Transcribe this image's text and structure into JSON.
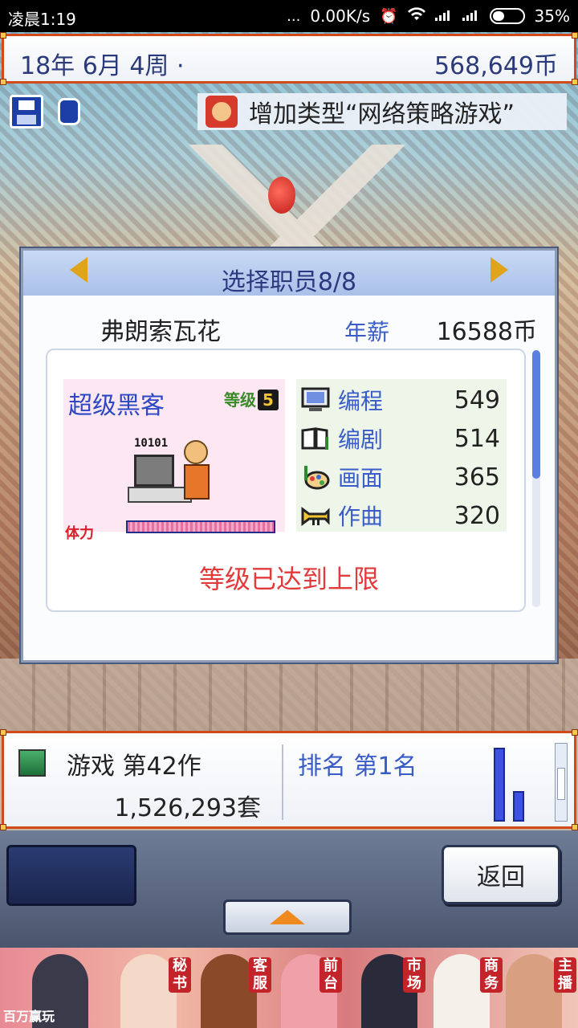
{
  "status_bar": {
    "time": "凌晨1:19",
    "dots": "...",
    "network_speed": "0.00K/s",
    "battery": "35%"
  },
  "top_bar": {
    "date": "18年 6月 4周 ·",
    "money": "568,649币"
  },
  "notice": {
    "text": "增加类型“网络策略游戏”"
  },
  "dialog": {
    "title": "选择职员8/8",
    "employee_name": "弗朗索瓦花",
    "salary_label": "年薪",
    "salary_value": "16588币",
    "job_title": "超级黑客",
    "level_label": "等级",
    "level_value": "5",
    "binary_text": "10101",
    "stamina_label": "体力",
    "stamina_fraction": 1.0,
    "skills": [
      {
        "name": "编程",
        "value": "549",
        "icon": "computer-icon"
      },
      {
        "name": "编剧",
        "value": "514",
        "icon": "book-icon"
      },
      {
        "name": "画面",
        "value": "365",
        "icon": "palette-icon"
      },
      {
        "name": "作曲",
        "value": "320",
        "icon": "trumpet-icon"
      }
    ],
    "max_level_text": "等级已达到上限"
  },
  "bottom_bar": {
    "game_label": "游戏 第42作",
    "sales": "1,526,293套",
    "rank": "排名 第1名"
  },
  "buttons": {
    "back": "返回"
  },
  "ad": {
    "tags": [
      "秘书",
      "客服",
      "前台",
      "市场",
      "商务",
      "主播"
    ],
    "logo": "百万赢玩"
  },
  "colors": {
    "accent_blue": "#3a5cc8",
    "title_blue": "#2b3a80",
    "warning_red": "#e23a3a",
    "frame_orange": "#d2491a"
  }
}
